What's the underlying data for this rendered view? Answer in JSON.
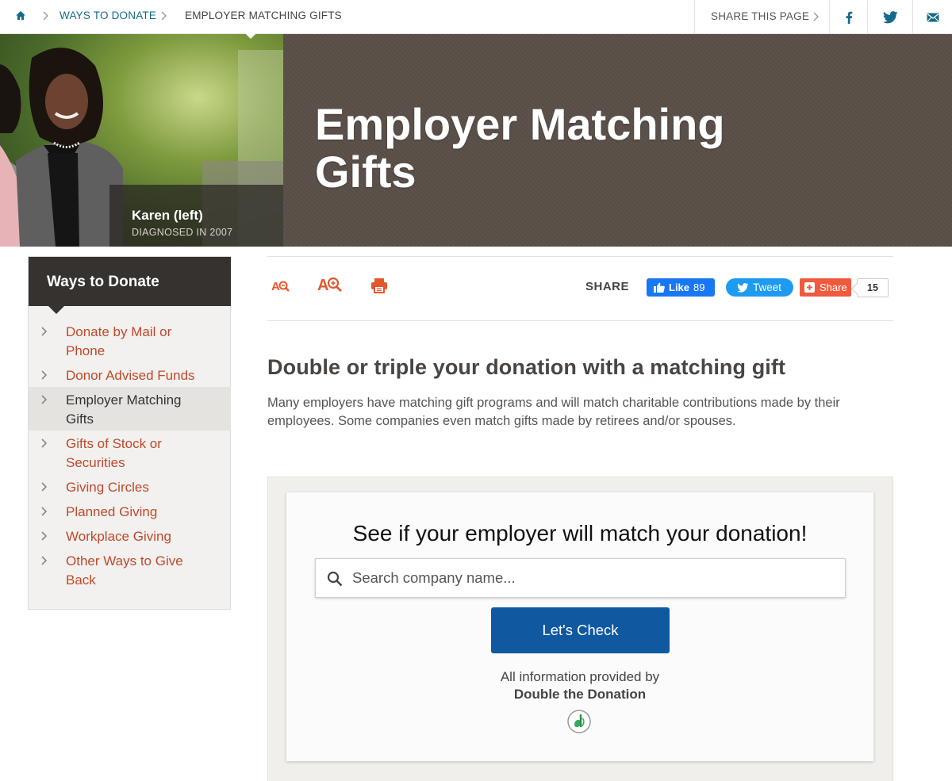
{
  "breadcrumb": {
    "items": [
      "WAYS TO DONATE",
      "EMPLOYER MATCHING GIFTS"
    ]
  },
  "share_bar": {
    "label": "SHARE THIS PAGE",
    "icons": [
      "facebook-icon",
      "twitter-icon",
      "email-icon"
    ]
  },
  "hero": {
    "title": "Employer Matching Gifts",
    "caption_name": "Karen (left)",
    "caption_sub": "DIAGNOSED IN 2007"
  },
  "sidebar": {
    "title": "Ways to Donate",
    "items": [
      {
        "label": "Donate by Mail or Phone",
        "active": false
      },
      {
        "label": "Donor Advised Funds",
        "active": false
      },
      {
        "label": "Employer Matching Gifts",
        "active": true
      },
      {
        "label": "Gifts of Stock or Securities",
        "active": false
      },
      {
        "label": "Giving Circles",
        "active": false
      },
      {
        "label": "Planned Giving",
        "active": false
      },
      {
        "label": "Workplace Giving",
        "active": false
      },
      {
        "label": "Other Ways to Give Back",
        "active": false
      }
    ]
  },
  "toolbar": {
    "share_label": "SHARE",
    "fb_like_label": "Like",
    "fb_like_count": "89",
    "tweet_label": "Tweet",
    "share_btn_label": "Share",
    "share_count": "15"
  },
  "content": {
    "heading": "Double or triple your donation with a matching gift",
    "intro": "Many employers have matching gift programs and will match charitable contributions made by their employees. Some companies even match gifts made by retirees and/or spouses."
  },
  "widget": {
    "title": "See if your employer will match your donation!",
    "search_placeholder": "Search company name...",
    "button_label": "Let's Check",
    "info_line1": "All information provided by",
    "info_line2": "Double the Donation"
  },
  "colors": {
    "link": "#156b8a",
    "accent": "#c0492a",
    "hero_bg": "#5a4f48",
    "widget_button": "#1059a0"
  }
}
